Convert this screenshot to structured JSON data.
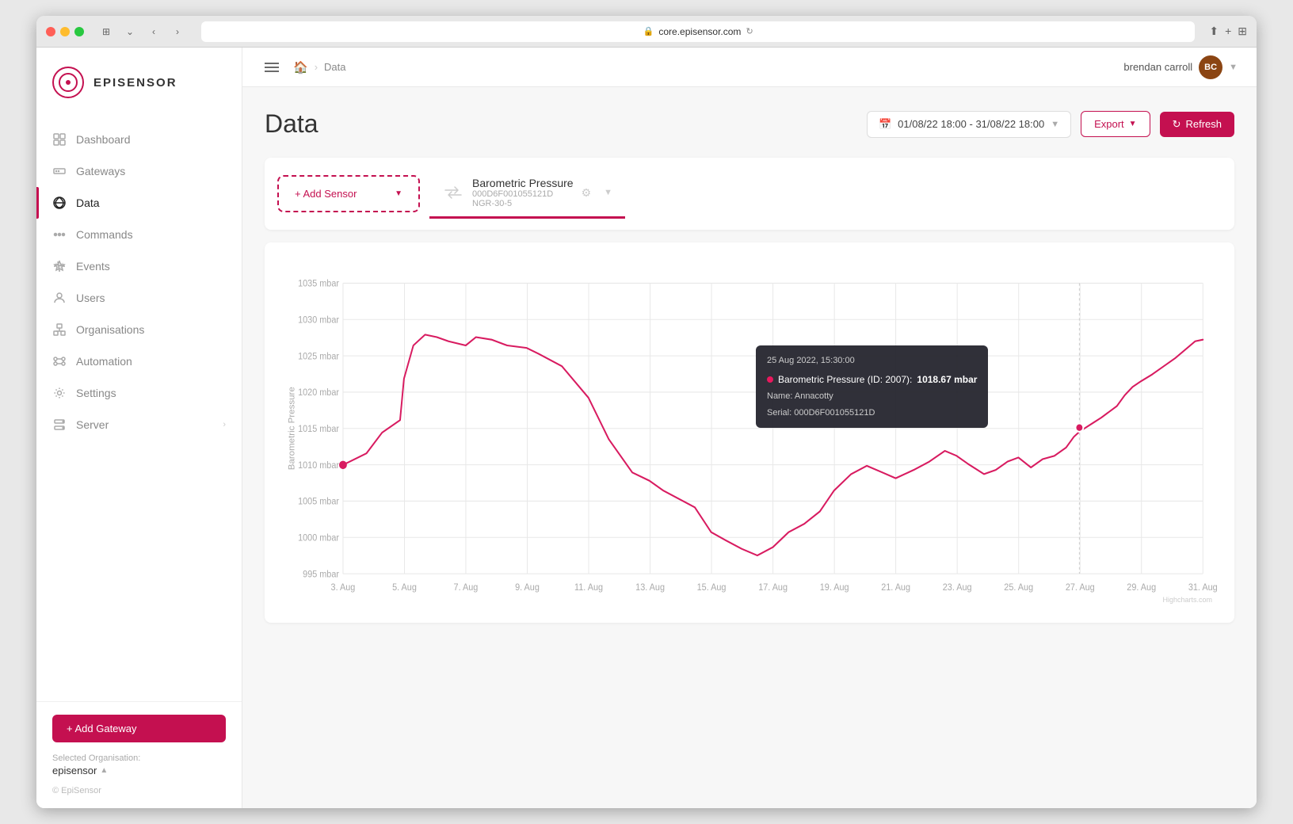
{
  "browser": {
    "url": "core.episensor.com",
    "shield_icon": "🛡"
  },
  "app": {
    "logo_text": "EPISENSOR",
    "user": {
      "name": "brendan carroll",
      "initials": "BC"
    }
  },
  "nav": {
    "items": [
      {
        "id": "dashboard",
        "label": "Dashboard",
        "icon": "grid",
        "active": false
      },
      {
        "id": "gateways",
        "label": "Gateways",
        "icon": "router",
        "active": false
      },
      {
        "id": "data",
        "label": "Data",
        "icon": "globe",
        "active": true
      },
      {
        "id": "commands",
        "label": "Commands",
        "icon": "dots",
        "active": false
      },
      {
        "id": "events",
        "label": "Events",
        "icon": "bell",
        "active": false
      },
      {
        "id": "users",
        "label": "Users",
        "icon": "person",
        "active": false
      },
      {
        "id": "organisations",
        "label": "Organisations",
        "icon": "building",
        "active": false
      },
      {
        "id": "automation",
        "label": "Automation",
        "icon": "network",
        "active": false
      },
      {
        "id": "settings",
        "label": "Settings",
        "icon": "gear",
        "active": false
      },
      {
        "id": "server",
        "label": "Server",
        "icon": "server",
        "active": false
      }
    ],
    "add_gateway_label": "+ Add Gateway",
    "org_label": "Selected Organisation:",
    "org_name": "episensor",
    "copyright": "© EpiSensor"
  },
  "breadcrumb": {
    "home": "🏠",
    "separator": "›",
    "current": "Data"
  },
  "page": {
    "title": "Data",
    "date_range": "01/08/22 18:00 - 31/08/22 18:00",
    "export_label": "Export",
    "refresh_label": "Refresh"
  },
  "sensor": {
    "add_label": "+ Add Sensor",
    "name": "Barometric Pressure",
    "serial": "000D6F001055121D",
    "model": "NGR-30-5"
  },
  "chart": {
    "y_axis_label": "Barometric Pressure",
    "y_ticks": [
      "1035 mbar",
      "1030 mbar",
      "1025 mbar",
      "1020 mbar",
      "1015 mbar",
      "1010 mbar",
      "1005 mbar",
      "1000 mbar",
      "995 mbar"
    ],
    "x_ticks": [
      "3. Aug",
      "5. Aug",
      "7. Aug",
      "9. Aug",
      "11. Aug",
      "13. Aug",
      "15. Aug",
      "17. Aug",
      "19. Aug",
      "21. Aug",
      "23. Aug",
      "25. Aug",
      "27. Aug",
      "29. Aug",
      "31. Aug"
    ],
    "credits": "Highcharts.com"
  },
  "tooltip": {
    "timestamp": "25 Aug 2022, 15:30:00",
    "sensor_label": "Barometric Pressure (ID: 2007):",
    "value": "1018.67 mbar",
    "name_label": "Name:",
    "name_value": "Annacotty",
    "serial_label": "Serial:",
    "serial_value": "000D6F001055121D"
  }
}
